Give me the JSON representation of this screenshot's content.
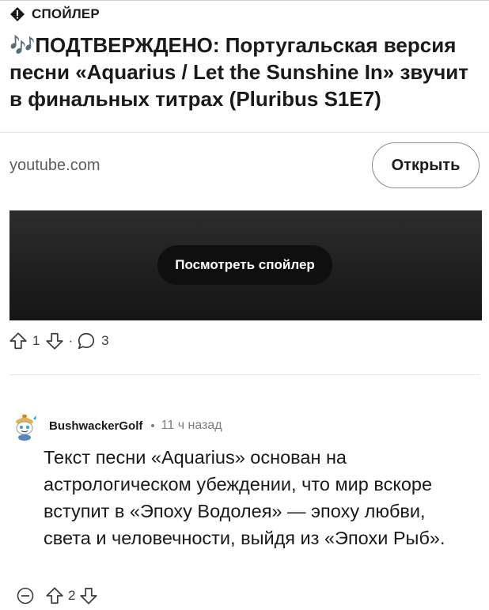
{
  "post": {
    "spoiler_label": "СПОЙЛЕР",
    "title": "🎶ПОДТВЕРЖДЕНО: Португальская версия песни «Aquarius / Let the Sunshine In» звучит в финальных титрах (Pluribus S1E7)",
    "link_domain": "youtube.com",
    "open_button": "Открыть",
    "reveal_spoiler_button": "Посмотреть спойлер",
    "upvotes": "1",
    "separator": "·",
    "comments_count": "3"
  },
  "comment": {
    "username": "BushwackerGolf",
    "separator": "•",
    "timestamp": "11 ч назад",
    "text": "Текст песни «Aquarius» основан на астрологическом убеждении, что мир вскоре вступит в «Эпоху Водолея» — эпоху любви, света и человечности, выйдя из «Эпохи Рыб».",
    "upvotes": "2"
  },
  "icons": {
    "spoiler": "alert-diamond-icon",
    "upvote": "arrow-up-icon",
    "downvote": "arrow-down-icon",
    "comments": "speech-bubble-icon",
    "avatar": "snoo-avatar-icon",
    "collapse": "collapse-minus-icon"
  },
  "colors": {
    "text": "#1a1a1b",
    "muted": "#7c7c7c",
    "spoiler_overlay": "#1f1f1f",
    "reveal_button_bg": "#0f0f0f"
  }
}
